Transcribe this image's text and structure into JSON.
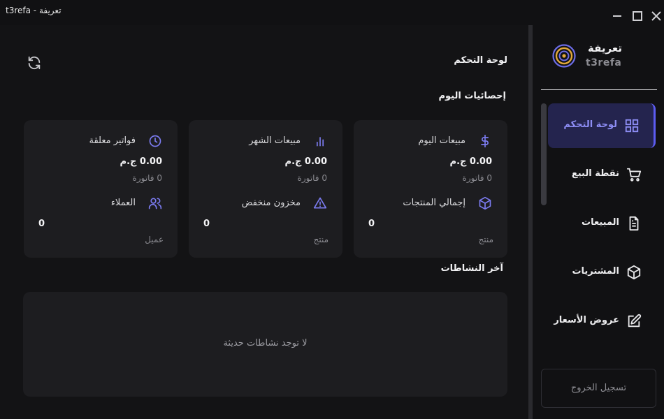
{
  "window": {
    "title": "t3refa - تعريفة",
    "controls": {
      "minimize": "minimize-icon",
      "maximize": "maximize-icon",
      "close": "close-icon"
    }
  },
  "brand": {
    "name": "تعريفة",
    "subtitle": "t3refa"
  },
  "sidebar": {
    "items": [
      {
        "label": "لوحة التحكم",
        "icon": "grid-icon",
        "active": true
      },
      {
        "label": "نقطة البيع",
        "icon": "cart-icon",
        "active": false
      },
      {
        "label": "المبيعات",
        "icon": "document-icon",
        "active": false
      },
      {
        "label": "المشتريات",
        "icon": "box-icon",
        "active": false
      },
      {
        "label": "عروض الأسعار",
        "icon": "edit-icon",
        "active": false
      }
    ],
    "logout_label": "تسجيل الخروج"
  },
  "main": {
    "page_title": "لوحة التحكم",
    "stats_title": "إحصائيات اليوم",
    "cards": [
      {
        "top_title": "مبيعات اليوم",
        "top_icon": "dollar-icon",
        "value": "0.00 ج.م",
        "sub": "0 فاتورة",
        "bottom_title": "إجمالي المنتجات",
        "bottom_icon": "box-icon",
        "count": "0",
        "unit": "منتج"
      },
      {
        "top_title": "مبيعات الشهر",
        "top_icon": "bar-chart-icon",
        "value": "0.00 ج.م",
        "sub": "0 فاتورة",
        "bottom_title": "مخزون منخفض",
        "bottom_icon": "warning-icon",
        "count": "0",
        "unit": "منتج"
      },
      {
        "top_title": "فواتير معلقة",
        "top_icon": "clock-icon",
        "value": "0.00 ج.م",
        "sub": "0 فاتورة",
        "bottom_title": "العملاء",
        "bottom_icon": "users-icon",
        "count": "0",
        "unit": "عميل"
      }
    ],
    "activity_title": "آخر النشاطات",
    "activity_empty": "لا توجد نشاطات حديثة"
  },
  "colors": {
    "accent": "#7c7cf2",
    "active_bg": "#24244e",
    "card_bg": "#1d1d20",
    "bg": "#131315"
  }
}
